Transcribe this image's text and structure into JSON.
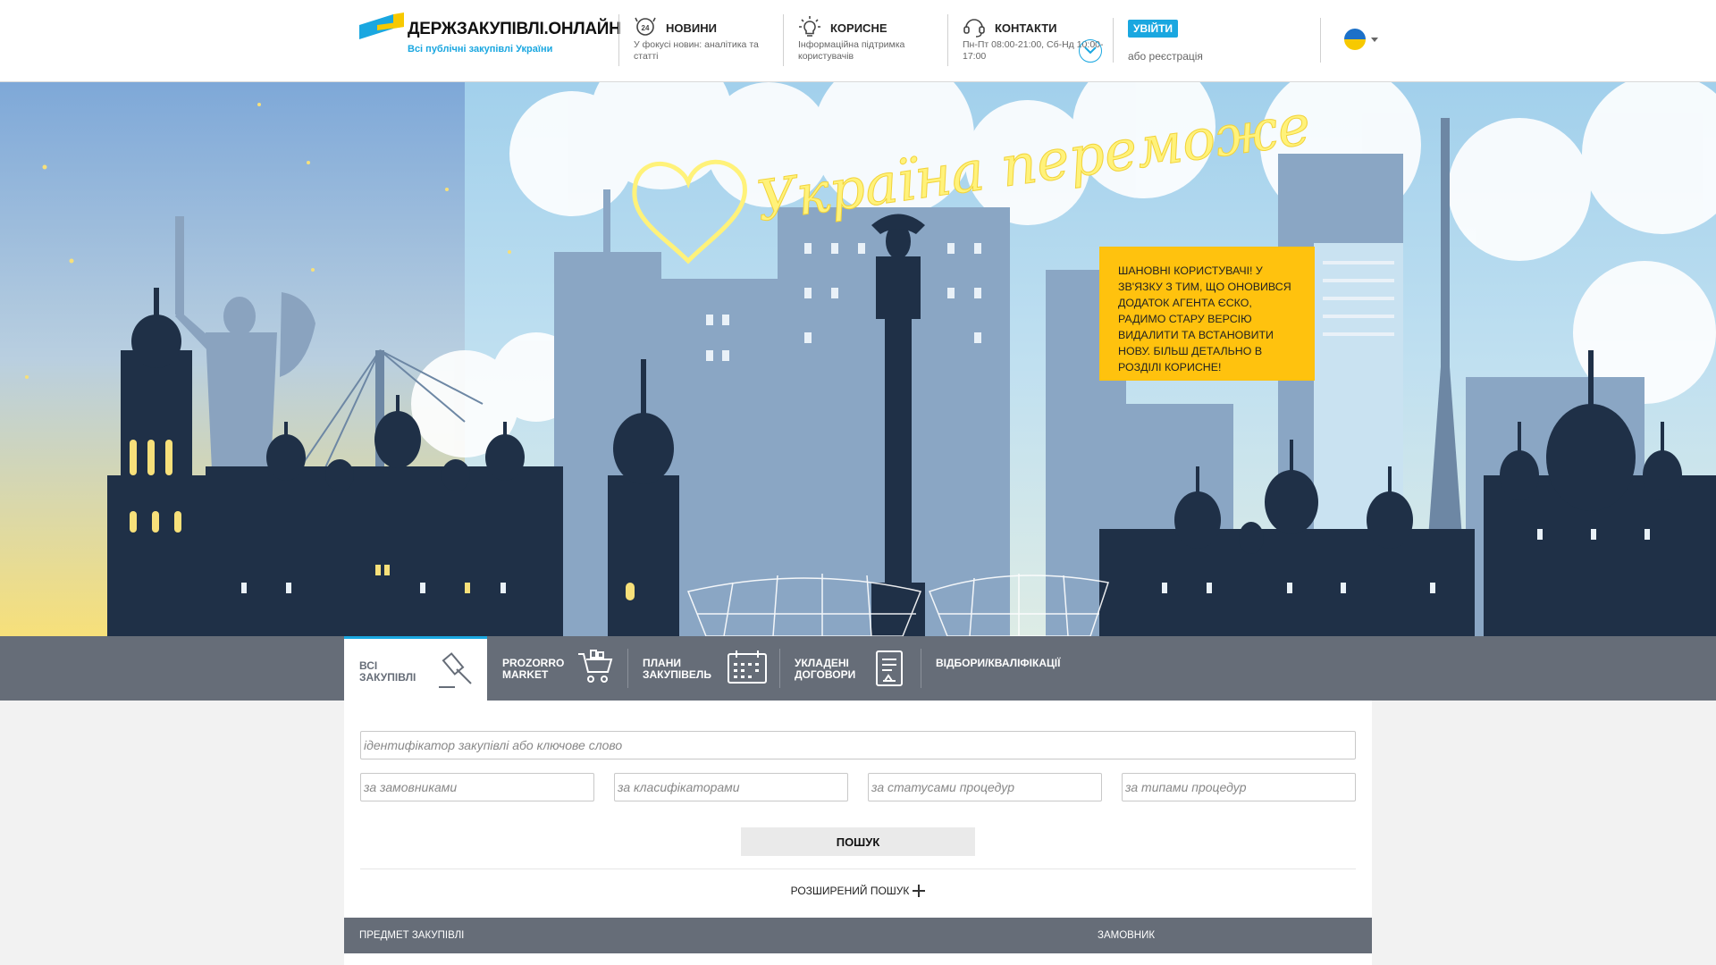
{
  "header": {
    "logo_title": "ДЕРЖЗАКУПІВЛІ.ОНЛАЙН",
    "logo_subtitle": "Всі публічні закупівлі України",
    "nav": [
      {
        "title": "НОВИНИ",
        "text": "У фокусі новин: аналітика та статті",
        "icon": "news-24-icon"
      },
      {
        "title": "КОРИСНЕ",
        "text": "Інформаційна підтримка користувачів",
        "icon": "lightbulb-icon"
      },
      {
        "title": "КОНТАКТИ",
        "text": "Пн-Пт 08:00-21:00, Сб-Нд 10:00-17:00",
        "icon": "support-headset-icon"
      }
    ],
    "login_label": "УВІЙТИ",
    "register_label": "або реєстрація",
    "language": "uk"
  },
  "hero": {
    "neon_text": "Україна переможе",
    "notice": "ШАНОВНІ КОРИСТУВАЧІ! У ЗВ'ЯЗКУ З ТИМ, ЩО ОНОВИВСЯ ДОДАТОК АГЕНТА ЄСКО, РАДИМО СТАРУ ВЕРСІЮ ВИДАЛИТИ ТА ВСТАНОВИТИ НОВУ. БІЛЬШ ДЕТАЛЬНО В РОЗДІЛІ КОРИСНЕ!",
    "colors": {
      "sky_top": "#7ea8d8",
      "sky_bottom": "#f7e07a",
      "silhouette": "#1f3047",
      "neon": "#fff27a"
    }
  },
  "tabs": [
    {
      "label": "ВСІ\nЗАКУПІВЛІ",
      "active": true,
      "icon": "gavel-icon"
    },
    {
      "label": "PROZORRO\nMARKET",
      "active": false,
      "icon": "cart-icon"
    },
    {
      "label": "ПЛАНИ\nЗАКУПІВЕЛЬ",
      "active": false,
      "icon": "calendar-icon"
    },
    {
      "label": "УКЛАДЕНІ\nДОГОВОРИ",
      "active": false,
      "icon": "contract-icon"
    },
    {
      "label": "ВІДБОРИ/КВАЛІФІКАЦІЇ",
      "active": false
    }
  ],
  "search": {
    "main_placeholder": "ідентифікатор закупівлі або ключове слово",
    "filters": [
      {
        "placeholder": "за замовниками"
      },
      {
        "placeholder": "за класифікаторами"
      },
      {
        "placeholder": "за статусами процедур"
      },
      {
        "placeholder": "за типами процедур"
      }
    ],
    "button_label": "ПОШУК",
    "advanced_label": "РОЗШИРЕНИЙ ПОШУК"
  },
  "table": {
    "columns": [
      "ПРЕДМЕТ ЗАКУПІВЛІ",
      "ЗАМОВНИК"
    ]
  }
}
